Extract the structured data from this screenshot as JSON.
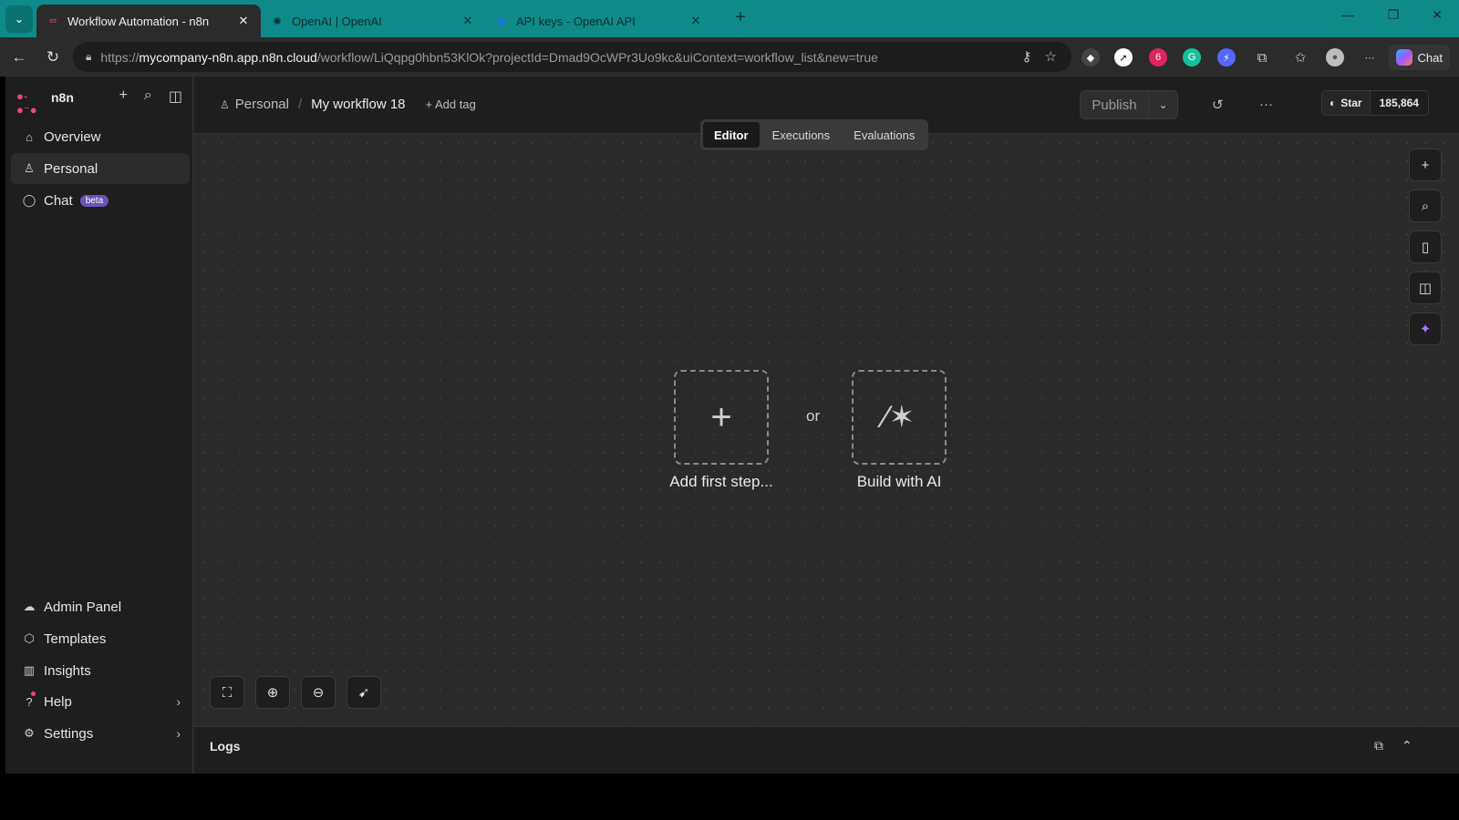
{
  "browser": {
    "tabs": [
      {
        "title": "Workflow Automation - n8n",
        "favicon": "n8n-logo-icon",
        "active": true
      },
      {
        "title": "OpenAI | OpenAI",
        "favicon": "openai-icon",
        "active": false
      },
      {
        "title": "API keys - OpenAI API",
        "favicon": "globe-icon",
        "active": false
      }
    ],
    "url_host": "mycompany-n8n.app.n8n.cloud",
    "url_prefix": "https://",
    "url_path": "/workflow/LiQqpg0hbn53KlOk?projectId=Dmad9OcWPr3Uo9kc&uiContext=workflow_list&new=true",
    "chat_label": "Chat"
  },
  "sidebar": {
    "brand": "n8n",
    "items": [
      {
        "label": "Overview",
        "icon": "home-icon"
      },
      {
        "label": "Personal",
        "icon": "user-icon"
      },
      {
        "label": "Chat",
        "icon": "chat-icon",
        "badge": "beta"
      }
    ],
    "bottom_items": [
      {
        "label": "Admin Panel",
        "icon": "cloud-icon"
      },
      {
        "label": "Templates",
        "icon": "box-icon"
      },
      {
        "label": "Insights",
        "icon": "bar-chart-icon"
      },
      {
        "label": "Help",
        "icon": "help-icon"
      },
      {
        "label": "Settings",
        "icon": "gear-icon"
      }
    ]
  },
  "header": {
    "project": "Personal",
    "workflow_name": "My workflow 18",
    "add_tag": "+ Add tag",
    "publish": "Publish",
    "github_star": "Star",
    "github_count": "185,864"
  },
  "view_tabs": [
    "Editor",
    "Executions",
    "Evaluations"
  ],
  "canvas": {
    "add_first_step": "Add first step...",
    "or": "or",
    "build_with_ai": "Build with AI"
  },
  "logs": {
    "label": "Logs"
  }
}
